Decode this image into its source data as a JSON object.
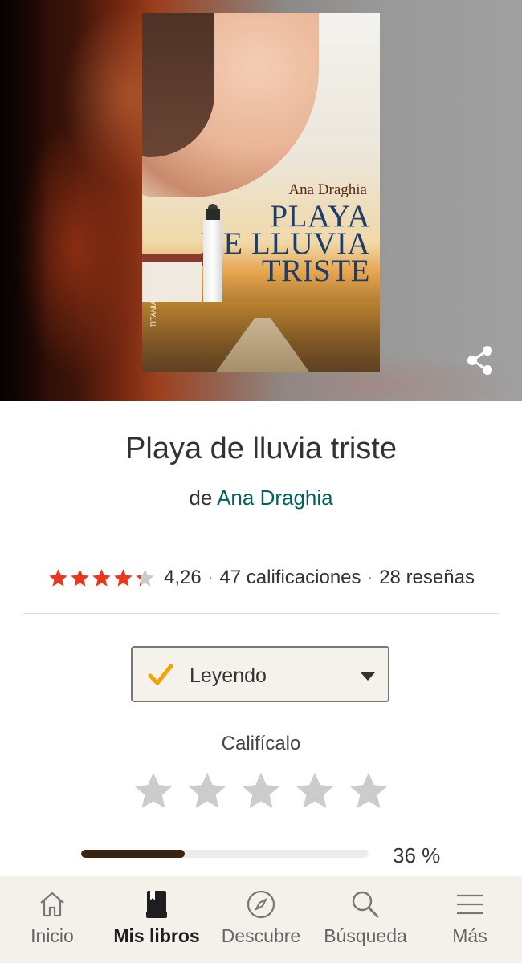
{
  "book": {
    "title": "Playa de lluvia triste",
    "by_prefix": "de",
    "author": "Ana Draghia"
  },
  "cover": {
    "author": "Ana Draghia",
    "title_lines": [
      "PLAYA",
      "DE LLUVIA",
      "TRISTE"
    ],
    "publisher": "TITANIA"
  },
  "hero": {
    "share_icon": "share-icon"
  },
  "ratings": {
    "average": "4,26",
    "average_value": 4.26,
    "max": 5,
    "ratings_count": "47 calificaciones",
    "reviews_count": "28 reseñas",
    "star_color": "#e8391e",
    "empty_star_color": "#cccccc"
  },
  "shelf": {
    "status": "Leyendo",
    "check_color": "#f0a500",
    "dropdown_icon": "caret-down-icon"
  },
  "rate": {
    "label": "Califícalo",
    "user_rating": 0,
    "max": 5
  },
  "progress": {
    "percent_text": "36 %",
    "value": 0.36
  },
  "nav": {
    "items": [
      {
        "label": "Inicio",
        "icon": "home-icon",
        "active": false
      },
      {
        "label": "Mis libros",
        "icon": "book-icon",
        "active": true
      },
      {
        "label": "Descubre",
        "icon": "compass-icon",
        "active": false
      },
      {
        "label": "Búsqueda",
        "icon": "search-icon",
        "active": false
      },
      {
        "label": "Más",
        "icon": "menu-icon",
        "active": false
      }
    ]
  }
}
